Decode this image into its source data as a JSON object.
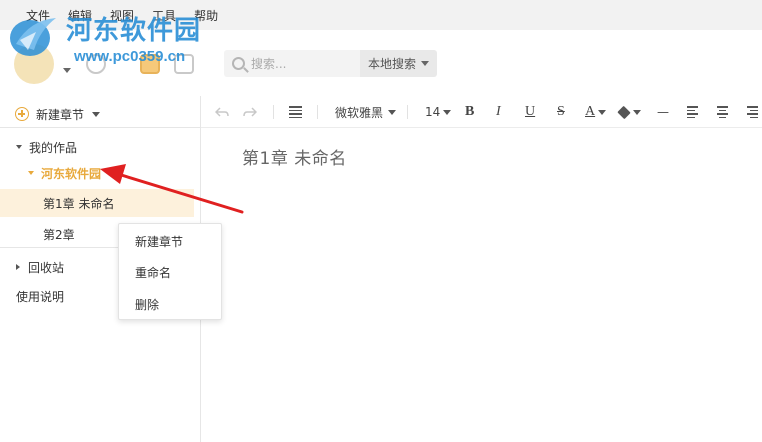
{
  "menu": [
    "文件",
    "编辑",
    "视图",
    "工具",
    "帮助"
  ],
  "watermark": {
    "brand": "河东软件园",
    "url": "www.pc0359.cn"
  },
  "search": {
    "placeholder": "搜索...",
    "scope": "本地搜索"
  },
  "sidebar": {
    "new_chapter": "新建章节",
    "tree": {
      "root": "我的作品",
      "book": "河东软件园",
      "chapters": [
        "第1章 未命名",
        "第2章"
      ]
    },
    "recycle": "回收站",
    "help": "使用说明"
  },
  "editor_toolbar": {
    "font": "微软雅黑",
    "size": "14",
    "bold": "B",
    "italic": "I",
    "underline": "U",
    "strike": "S",
    "color": "A",
    "hr": "—"
  },
  "document": {
    "title": "第1章  未命名"
  },
  "context_menu": [
    "新建章节",
    "重命名",
    "删除"
  ],
  "colors": {
    "accent": "#e8a93c",
    "selected_row": "#fdf1dc",
    "arrow": "#e02020",
    "watermark": "#2a8fd6"
  }
}
